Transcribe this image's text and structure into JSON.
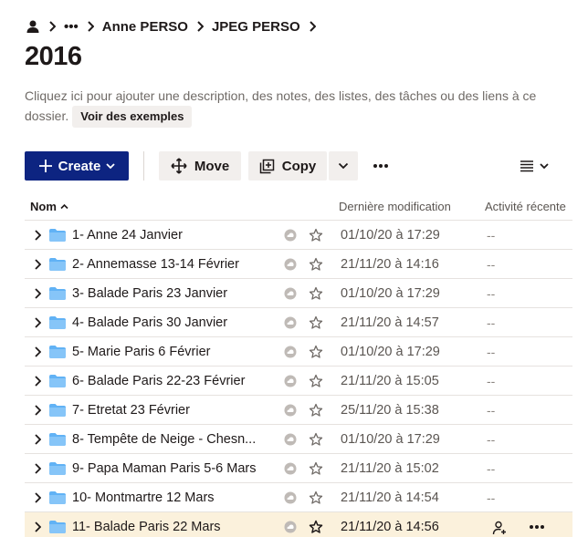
{
  "breadcrumb": {
    "ellipsis": "•••",
    "items": [
      "Anne PERSO",
      "JPEG PERSO"
    ]
  },
  "title": "2016",
  "description": {
    "text": "Cliquez ici pour ajouter une description, des notes, des listes, des tâches ou des liens à ce dossier.",
    "examples_label": "Voir des exemples"
  },
  "toolbar": {
    "create_label": "Create",
    "move_label": "Move",
    "copy_label": "Copy"
  },
  "table": {
    "columns": {
      "name": "Nom",
      "modified": "Dernière modification",
      "activity": "Activité récente"
    },
    "rows": [
      {
        "name": "1- Anne 24 Janvier",
        "modified": "01/10/20 à 17:29",
        "activity": "--"
      },
      {
        "name": "2- Annemasse 13-14 Février",
        "modified": "21/11/20 à 14:16",
        "activity": "--"
      },
      {
        "name": "3- Balade Paris 23 Janvier",
        "modified": "01/10/20 à 17:29",
        "activity": "--"
      },
      {
        "name": "4- Balade Paris 30 Janvier",
        "modified": "21/11/20 à 14:57",
        "activity": "--"
      },
      {
        "name": "5- Marie Paris 6 Février",
        "modified": "01/10/20 à 17:29",
        "activity": "--"
      },
      {
        "name": "6- Balade Paris 22-23 Février",
        "modified": "21/11/20 à 15:05",
        "activity": "--"
      },
      {
        "name": "7- Etretat 23 Février",
        "modified": "25/11/20 à 15:38",
        "activity": "--"
      },
      {
        "name": "8- Tempête de Neige - Chesn...",
        "modified": "01/10/20 à 17:29",
        "activity": "--"
      },
      {
        "name": "9- Papa Maman Paris 5-6 Mars",
        "modified": "21/11/20 à 15:02",
        "activity": "--"
      },
      {
        "name": "10- Montmartre 12 Mars",
        "modified": "21/11/20 à 14:54",
        "activity": "--"
      },
      {
        "name": "11- Balade Paris 22 Mars",
        "modified": "21/11/20 à 14:56",
        "activity": ""
      }
    ]
  },
  "icons": {
    "person": "person-icon",
    "folder": "folder-icon",
    "star": "star-icon",
    "sync": "sync-status-icon",
    "share": "share-icon",
    "more": "more-icon"
  },
  "colors": {
    "primary": "#0d2481",
    "folder": "#61b2f5",
    "highlight_row": "#fbf1dc",
    "secondary_button": "#f2efed"
  }
}
